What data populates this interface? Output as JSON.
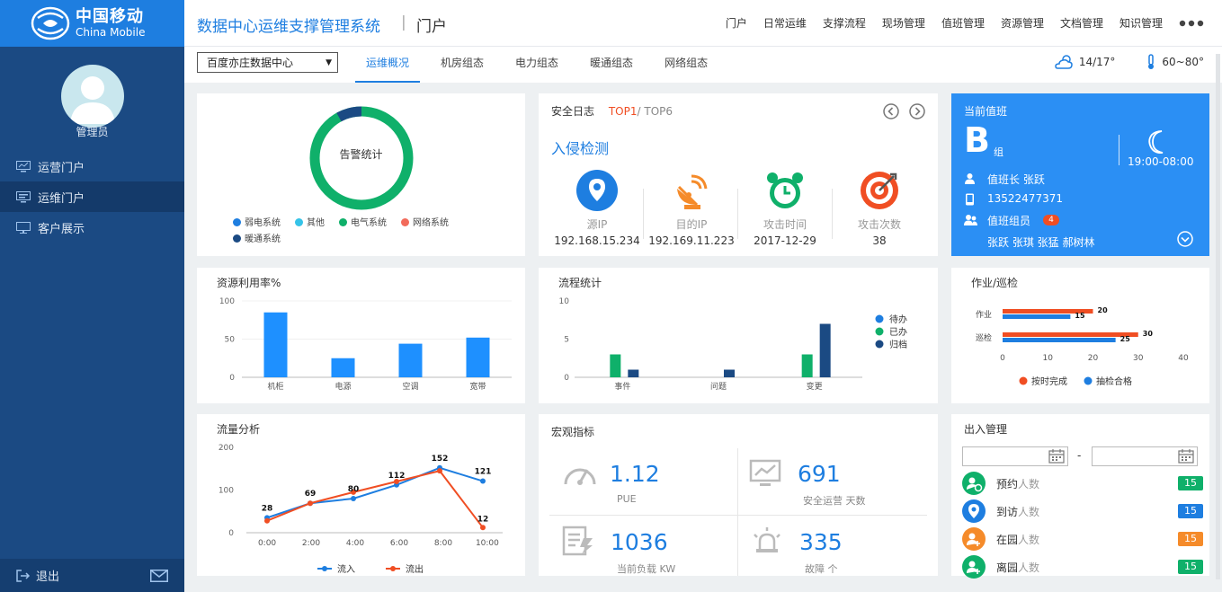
{
  "brand": {
    "cn": "中国移动",
    "en": "China Mobile"
  },
  "header": {
    "title": "数据中心运维支撑管理系统",
    "separator": "|",
    "portal": "门户",
    "nav": [
      "门户",
      "日常运维",
      "支撑流程",
      "现场管理",
      "值班管理",
      "资源管理",
      "文档管理",
      "知识管理"
    ]
  },
  "sidebar": {
    "role": "管理员",
    "items": [
      "运营门户",
      "运维门户",
      "客户展示"
    ],
    "logout": "退出"
  },
  "subbar": {
    "datacenter": "百度亦庄数据中心",
    "tabs": [
      "运维概况",
      "机房组态",
      "电力组态",
      "暖通组态",
      "网络组态"
    ],
    "weather_temp": "14/17°",
    "humidity": "60~80°"
  },
  "alarm": {
    "center": "告警统计",
    "legend": [
      {
        "name": "弱电系统",
        "color": "#1e7ee0"
      },
      {
        "name": "其他",
        "color": "#35c3e8"
      },
      {
        "name": "电气系统",
        "color": "#0fb06a"
      },
      {
        "name": "网络系统",
        "color": "#f26b5b"
      },
      {
        "name": "暖通系统",
        "color": "#1b4a83"
      }
    ],
    "ring": [
      {
        "value": 92,
        "color": "#0fb06a"
      },
      {
        "value": 8,
        "color": "#1b4a83"
      }
    ]
  },
  "security": {
    "title": "安全日志",
    "top1": "TOP1",
    "slash": "/",
    "top6": "TOP6",
    "section": "入侵检测",
    "items": [
      {
        "label": "源IP",
        "value": "192.168.15.234"
      },
      {
        "label": "目的IP",
        "value": "192.169.11.223"
      },
      {
        "label": "攻击时间",
        "value": "2017-12-29"
      },
      {
        "label": "攻击次数",
        "value": "38"
      }
    ]
  },
  "duty": {
    "title": "当前值班",
    "group": "B",
    "group_suffix": "组",
    "shift": "19:00-08:00",
    "leader": "值班长 张跃",
    "phone": "13522477371",
    "members_label": "值班组员",
    "members_count": "4",
    "members": "张跃 张琪 张猛 郝树林"
  },
  "resource": {
    "title": "资源利用率%",
    "ylabels": [
      "100",
      "50",
      "0"
    ]
  },
  "process": {
    "title": "流程统计",
    "ylabels": [
      "10",
      "5",
      "0"
    ]
  },
  "inspect": {
    "title": "作业/巡检",
    "xlabels": [
      "0",
      "10",
      "20",
      "30",
      "40"
    ]
  },
  "traffic": {
    "title": "流量分析",
    "ylabels": [
      "200",
      "100",
      "0"
    ]
  },
  "macro": {
    "title": "宏观指标",
    "metrics": [
      {
        "value": "1.12",
        "label": "PUE",
        "icon": "gauge-icon"
      },
      {
        "value": "691",
        "label": "安全运营 天数",
        "icon": "monitor-chart-icon"
      },
      {
        "value": "1036",
        "label": "当前负载 KW",
        "icon": "load-icon"
      },
      {
        "value": "335",
        "label": "故障 个",
        "icon": "alarm-light-icon"
      }
    ]
  },
  "inout": {
    "title": "出入管理",
    "date_sep": "-",
    "rows": [
      {
        "label": "预约",
        "suffix": "人数",
        "value": "15",
        "icon_color": "#0fb06a",
        "badge_color": "#0fb06a"
      },
      {
        "label": "到访",
        "suffix": "人数",
        "value": "15",
        "icon_color": "#1e7ee0",
        "badge_color": "#1e7ee0"
      },
      {
        "label": "在园",
        "suffix": "人数",
        "value": "15",
        "icon_color": "#f58b2a",
        "badge_color": "#f58b2a"
      },
      {
        "label": "离园",
        "suffix": "人数",
        "value": "15",
        "icon_color": "#0fb06a",
        "badge_color": "#0fb06a"
      }
    ]
  },
  "chart_data": [
    {
      "type": "bar",
      "title": "资源利用率%",
      "categories": [
        "机柜",
        "电源",
        "空调",
        "宽带"
      ],
      "values": [
        85,
        25,
        44,
        52
      ],
      "ylim": [
        0,
        100
      ],
      "color": "#1e90ff"
    },
    {
      "type": "bar",
      "title": "流程统计",
      "categories": [
        "事件",
        "问题",
        "变更"
      ],
      "series": [
        {
          "name": "待办",
          "values": [
            3,
            0,
            3
          ],
          "color": "#0fb06a"
        },
        {
          "name": "已办",
          "values": [
            1,
            1,
            7
          ],
          "color": "#0fb06a"
        },
        {
          "name": "归档",
          "values": [
            1,
            1,
            7
          ],
          "color": "#1b4a83"
        }
      ],
      "ylim": [
        0,
        10
      ]
    },
    {
      "type": "bar",
      "title": "作业/巡检",
      "orientation": "horizontal",
      "categories": [
        "作业",
        "巡检"
      ],
      "series": [
        {
          "name": "按时完成",
          "values": [
            20,
            30
          ],
          "color": "#f04e23"
        },
        {
          "name": "抽检合格",
          "values": [
            15,
            25
          ],
          "color": "#1e7ee0"
        }
      ],
      "xlim": [
        0,
        40
      ]
    },
    {
      "type": "line",
      "title": "流量分析",
      "x": [
        "0:00",
        "2:00",
        "4:00",
        "6:00",
        "8:00",
        "10:00"
      ],
      "series": [
        {
          "name": "流入",
          "values": [
            35,
            69,
            80,
            112,
            152,
            121
          ],
          "color": "#1e7ee0"
        },
        {
          "name": "流出",
          "values": [
            28,
            69,
            95,
            120,
            145,
            12
          ],
          "color": "#f04e23"
        }
      ],
      "labels": [
        28,
        69,
        80,
        112,
        152,
        121,
        12
      ],
      "ylim": [
        0,
        200
      ]
    }
  ]
}
